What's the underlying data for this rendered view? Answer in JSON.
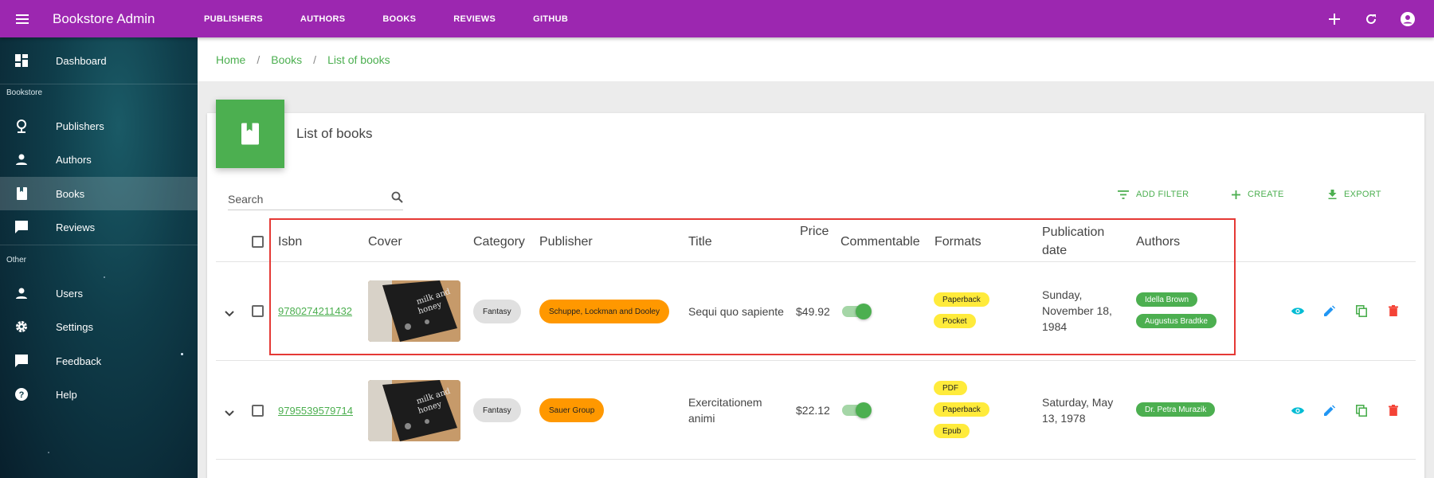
{
  "app": {
    "title": "Bookstore Admin"
  },
  "topnav": [
    "PUBLISHERS",
    "AUTHORS",
    "BOOKS",
    "REVIEWS",
    "GITHUB"
  ],
  "sidebar": {
    "dashboard": "Dashboard",
    "section_bookstore": "Bookstore",
    "items": [
      "Publishers",
      "Authors",
      "Books",
      "Reviews"
    ],
    "section_other": "Other",
    "other_items": [
      "Users",
      "Settings",
      "Feedback",
      "Help"
    ],
    "active": "Books"
  },
  "breadcrumb": [
    "Home",
    "Books",
    "List of books"
  ],
  "page": {
    "title": "List of books"
  },
  "search": {
    "placeholder": "Search"
  },
  "toolbar": {
    "add_filter": "ADD FILTER",
    "create": "CREATE",
    "export": "EXPORT"
  },
  "columns": {
    "isbn": "Isbn",
    "cover": "Cover",
    "category": "Category",
    "publisher": "Publisher",
    "title": "Title",
    "price": "Price",
    "commentable": "Commentable",
    "formats": "Formats",
    "publication_date_1": "Publication",
    "publication_date_2": "date",
    "authors": "Authors"
  },
  "rows": [
    {
      "isbn": "9780274211432",
      "category": "Fantasy",
      "publisher": "Schuppe, Lockman and Dooley",
      "title": "Sequi quo sapiente",
      "price": "$49.92",
      "commentable": true,
      "formats": [
        "Paperback",
        "Pocket"
      ],
      "date_lines": [
        "Sunday,",
        "November 18,",
        "1984"
      ],
      "authors": [
        "Idella Brown",
        "Augustus Bradtke"
      ]
    },
    {
      "isbn": "9795539579714",
      "category": "Fantasy",
      "publisher": "Sauer Group",
      "title_lines": [
        "Exercitationem",
        "animi"
      ],
      "price": "$22.12",
      "commentable": true,
      "formats": [
        "PDF",
        "Paperback",
        "Epub"
      ],
      "date_lines": [
        "Saturday, May",
        "13, 1978"
      ],
      "authors": [
        "Dr. Petra Murazik"
      ]
    }
  ],
  "colors": {
    "appbar": "#9c27b0",
    "accent": "#4caf50",
    "chip_publisher": "#ff9800",
    "chip_format": "#ffeb3b",
    "highlight": "#e53935"
  },
  "cover_text": [
    "milk and",
    "honey"
  ]
}
